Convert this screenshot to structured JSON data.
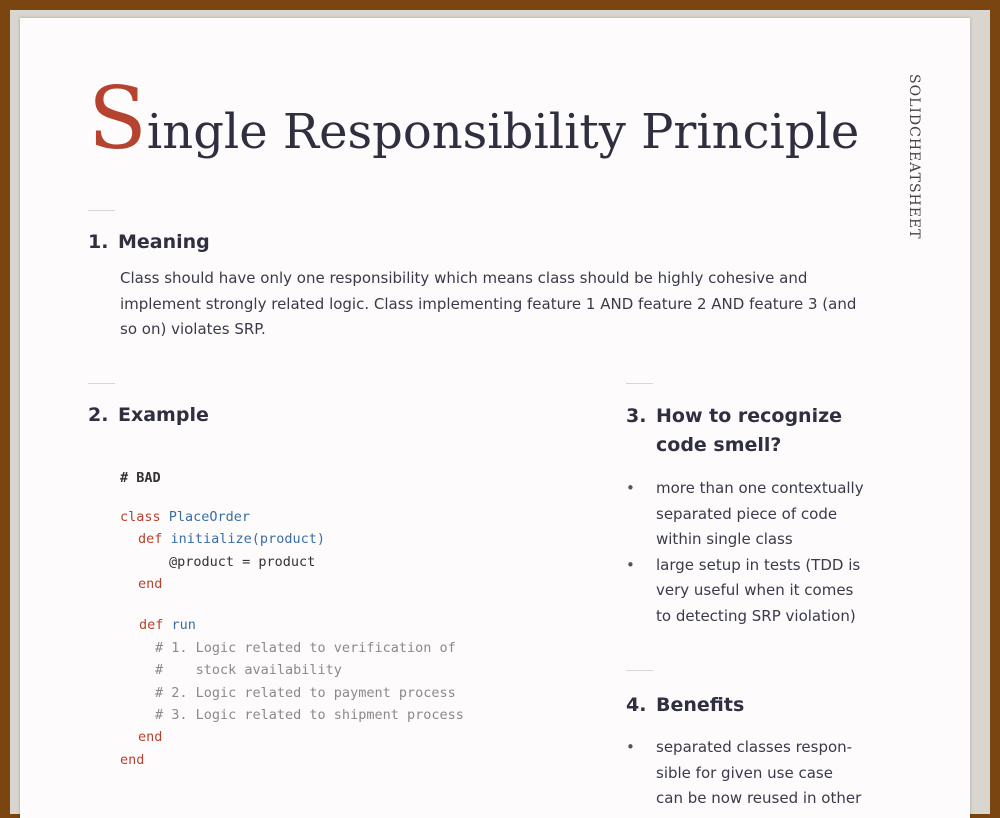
{
  "side_mark": "SOLIDCHEATSHEET",
  "title": {
    "dropcap": "S",
    "rest": "ingle Responsibility Principle"
  },
  "meaning": {
    "number": "1.",
    "heading": "Meaning",
    "lines": [
      "Class should have only one responsibility which means class should be highly cohesive and",
      "implement strongly related logic. Class implementing feature 1 AND feature 2 AND feature 3 (and",
      "so on) violates SRP."
    ]
  },
  "example": {
    "number": "2.",
    "heading": "Example",
    "code": {
      "bad_label": "# BAD",
      "class_kw": "class",
      "class_name": "PlaceOrder",
      "def_kw": "def",
      "init_sig": "initialize(product)",
      "assign": "@product = product",
      "end_kw": "end",
      "run_name": "run",
      "comments": [
        "# 1. Logic related to verification of",
        "#    stock availability",
        "# 2. Logic related to payment process",
        "# 3. Logic related to shipment process"
      ]
    }
  },
  "recognize": {
    "number": "3.",
    "heading_lines": [
      "How to recognize",
      "code smell?"
    ],
    "bullets": [
      [
        "more than one contextually",
        "separated piece of code",
        "within single class"
      ],
      [
        "large setup in tests (TDD is",
        "very useful when it comes",
        "to detecting SRP violation)"
      ]
    ]
  },
  "benefits": {
    "number": "4.",
    "heading": "Benefits",
    "bullets": [
      [
        "separated classes respon-",
        "sible for given use case",
        "can be now reused in other"
      ]
    ]
  }
}
